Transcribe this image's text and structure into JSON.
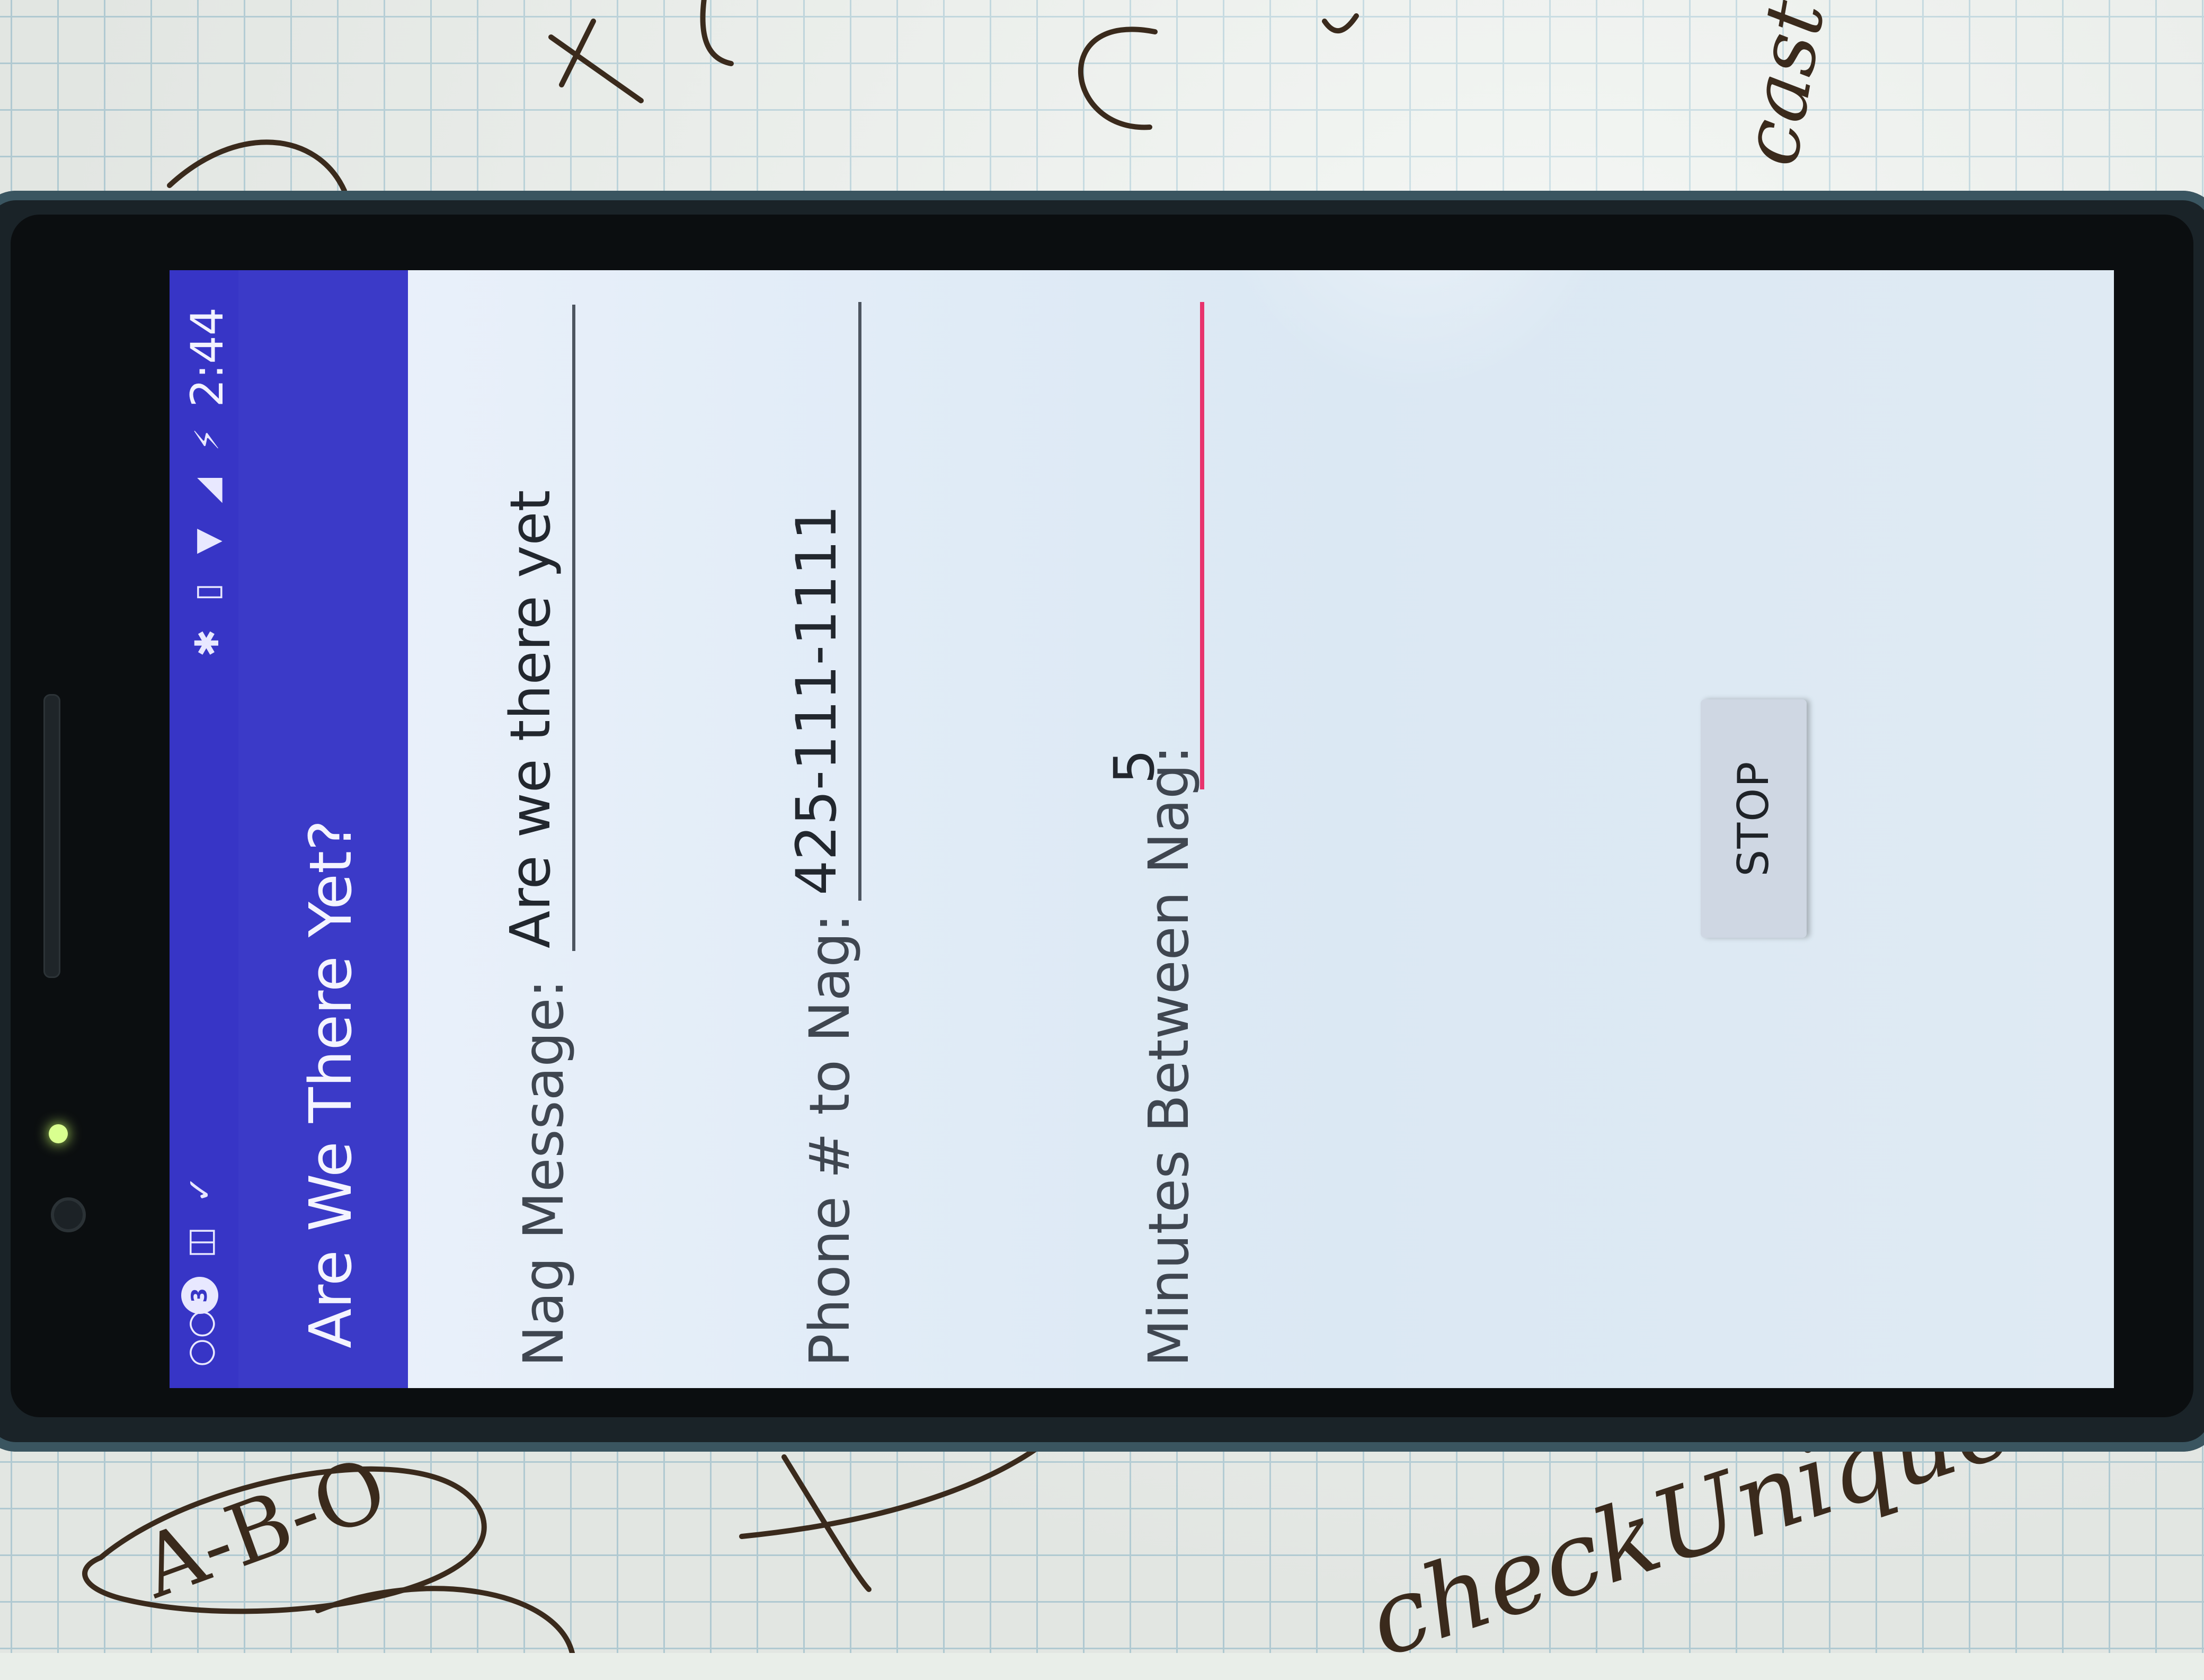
{
  "status_bar": {
    "notification_badge": "3",
    "time": "2:44",
    "left_icons": [
      "voicemail-icon",
      "chat-bubble-icon",
      "inbox-icon",
      "clipboard-check-icon"
    ],
    "right_icons": [
      "bluetooth-icon",
      "vibrate-icon",
      "wifi-icon",
      "signal-icon",
      "battery-charging-icon"
    ]
  },
  "toolbar": {
    "title": "Are We There Yet?",
    "color": "#3b3ac8"
  },
  "form": {
    "nag_message": {
      "label": "Nag Message:",
      "value": "Are we there yet"
    },
    "phone": {
      "label": "Phone # to Nag:",
      "value": "425-111-1111"
    },
    "minutes": {
      "label": "Minutes Between Nag:",
      "value": "5"
    }
  },
  "stop_button": {
    "label": "STOP"
  },
  "colors": {
    "accent": "#e8336d",
    "status_bar": "#3735c6"
  },
  "handwriting": [
    "A-B-O",
    "checkUnique",
    "cast"
  ]
}
